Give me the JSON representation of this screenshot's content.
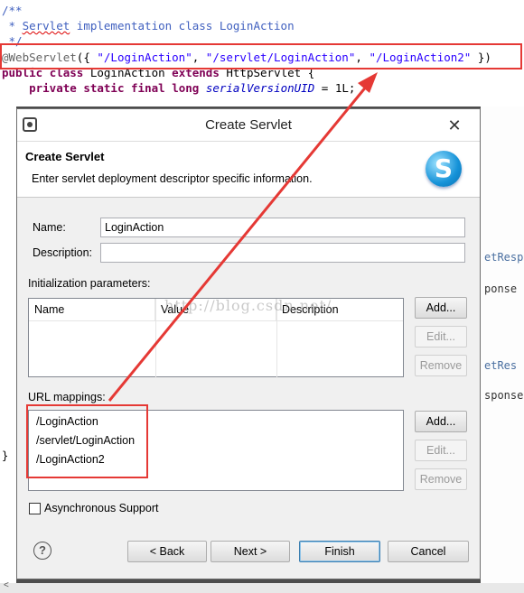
{
  "code": {
    "line1": "/**",
    "line2_prefix": " * ",
    "line2_word": "Servlet",
    "line2_rest": " implementation class LoginAction",
    "line3": " */",
    "anno_name": "@WebServlet",
    "anno_open": "({ ",
    "s1": "\"/LoginAction\"",
    "comma1": ", ",
    "s2": "\"/servlet/LoginAction\"",
    "comma2": ", ",
    "s3": "\"/LoginAction2\"",
    "anno_close": " })",
    "kw_public": "public",
    "kw_class": "class",
    "class_name": " LoginAction ",
    "kw_extends": "extends",
    "super_name": " HttpServlet {",
    "kw_private": "private",
    "kw_static": "static",
    "kw_final": "final",
    "kw_long": "long",
    "field": "serialVersionUID",
    "assign": " = 1L;",
    "right_frag1": "etResp",
    "right_frag2": "ponse",
    "right_frag3": "etRes",
    "right_frag4": "sponse",
    "left_brace": "}",
    "scroll_glyph": "<"
  },
  "dialog": {
    "title": "Create Servlet",
    "close_glyph": "✕",
    "logo_letter": "S",
    "header": "Create Servlet",
    "description": "Enter servlet deployment descriptor specific information.",
    "name_label": "Name:",
    "name_value": "LoginAction",
    "description_label": "Description:",
    "description_value": "",
    "init_label": "Initialization parameters:",
    "init_columns": [
      "Name",
      "Value",
      "Description"
    ],
    "watermark": "http://blog.csdn.net/",
    "url_label": "URL mappings:",
    "url_mappings": [
      "/LoginAction",
      "/servlet/LoginAction",
      "/LoginAction2"
    ],
    "add_label": "Add...",
    "edit_label": "Edit...",
    "remove_label": "Remove",
    "async_label": "Asynchronous Support",
    "async_checked": false,
    "help_glyph": "?",
    "back_label": "< Back",
    "next_label": "Next >",
    "finish_label": "Finish",
    "cancel_label": "Cancel"
  },
  "colors": {
    "annotation_red": "#e53935",
    "keyword": "#7f0055",
    "string": "#2a00ff",
    "comment": "#3f5fbf"
  }
}
